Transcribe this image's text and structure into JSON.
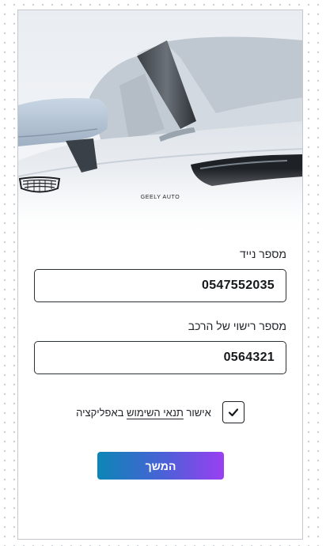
{
  "brand": {
    "logo_icon": "geely-shield-logo",
    "logo_text": "GEELY AUTO"
  },
  "form": {
    "phone_label": "מספר נייד",
    "phone_value": "0547552035",
    "plate_label": "מספר רישוי של הרכב",
    "plate_value": "0564321"
  },
  "consent": {
    "checked": true,
    "check_icon": "checkmark-icon",
    "prefix": "אישור ",
    "link_text": "תנאי השימוש",
    "suffix": " באפליקציה"
  },
  "actions": {
    "continue_label": "המשך"
  },
  "colors": {
    "button_gradient_start": "#0c86b6",
    "button_gradient_end": "#9b3ff2",
    "field_border": "#2c3136"
  }
}
